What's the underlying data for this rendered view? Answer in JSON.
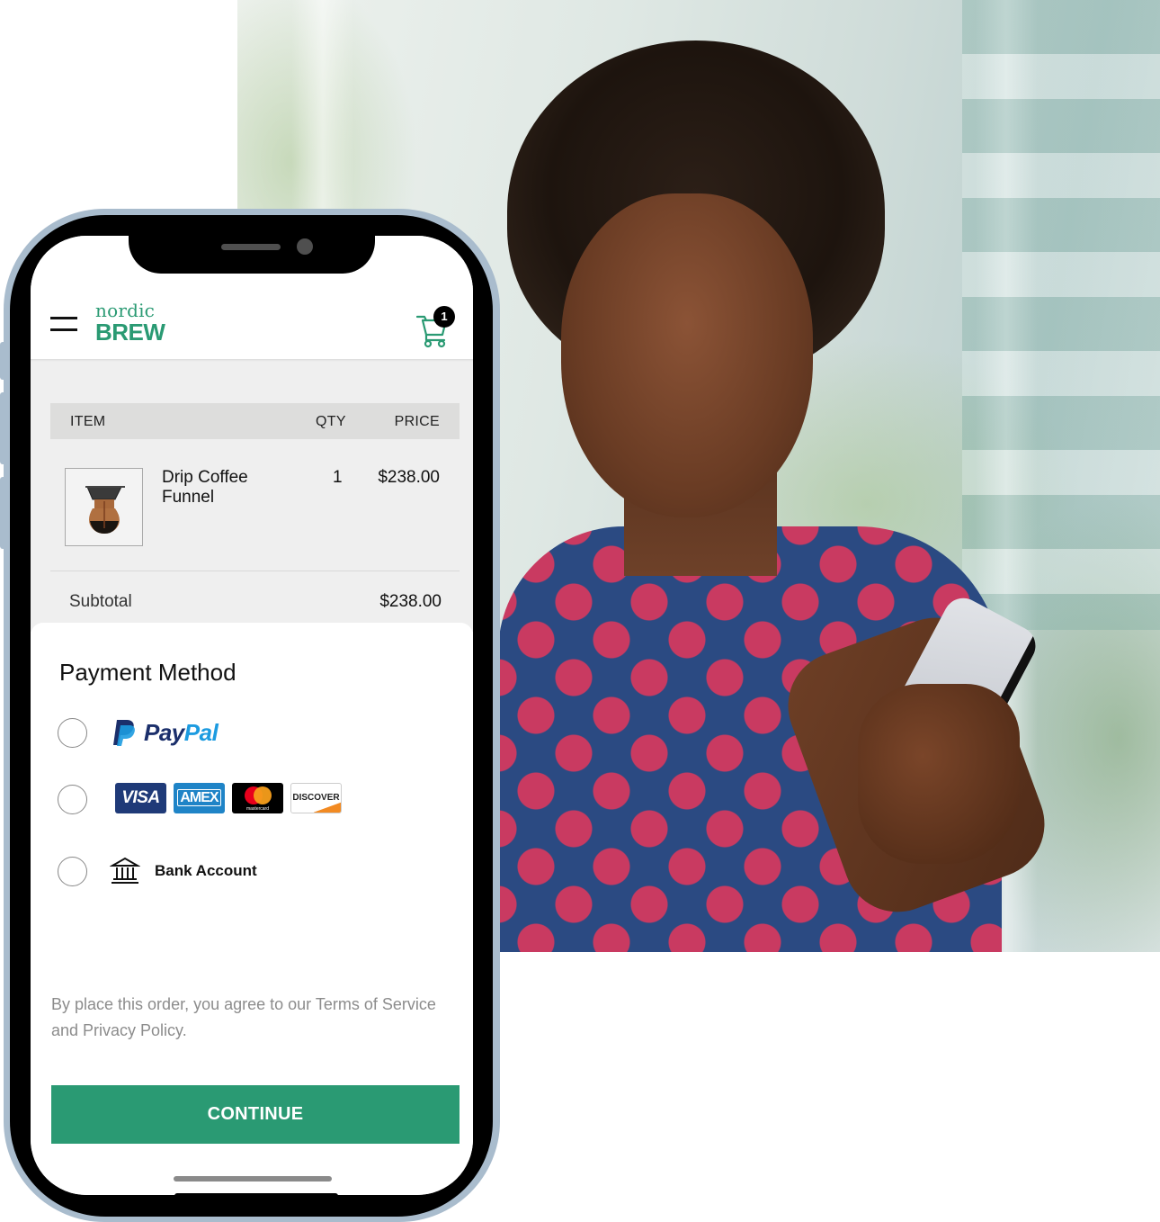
{
  "brand": {
    "name_top": "nordic",
    "name_bottom": "BREW",
    "accent_color": "#2a9a73"
  },
  "header": {
    "menu_icon": "hamburger-icon",
    "cart_icon": "shopping-cart-icon",
    "cart_count": "1"
  },
  "order": {
    "columns": {
      "item": "ITEM",
      "qty": "QTY",
      "price": "PRICE"
    },
    "items": [
      {
        "name": "Drip Coffee Funnel",
        "qty": "1",
        "price": "$238.00",
        "thumbnail_icon": "coffee-maker-image"
      }
    ],
    "subtotal_label": "Subtotal",
    "subtotal_value": "$238.00"
  },
  "payment": {
    "title": "Payment Method",
    "options": [
      {
        "id": "paypal",
        "label_part1": "Pay",
        "label_part2": "Pal",
        "selected": false
      },
      {
        "id": "cards",
        "cards": [
          "VISA",
          "AMEX",
          "mastercard",
          "DISCOVER"
        ],
        "selected": false
      },
      {
        "id": "bank",
        "label": "Bank Account",
        "icon": "bank-icon",
        "selected": false
      }
    ]
  },
  "terms_text": "By place this order, you agree to our Terms of Service and Privacy Policy.",
  "continue_label": "CONTINUE"
}
